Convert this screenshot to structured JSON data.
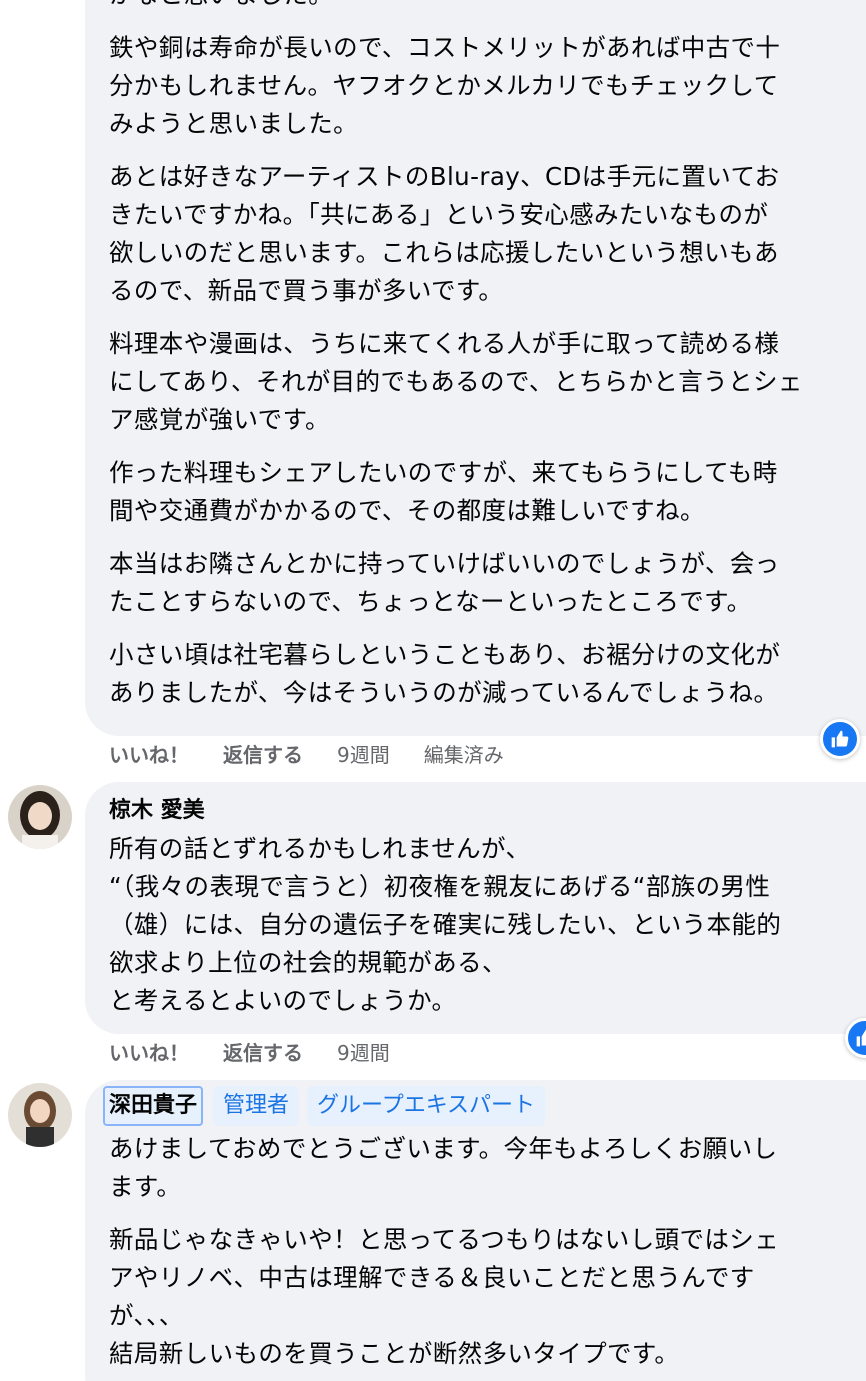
{
  "comment1": {
    "paragraphs": [
      {
        "lines": [
          "かなと思いました。"
        ]
      },
      {
        "lines": [
          "鉄や銅は寿命が長いので、コストメリットがあれば中古で十",
          "分かもしれません。ヤフオクとかメルカリでもチェックして",
          "みようと思いました。"
        ]
      },
      {
        "lines": [
          "あとは好きなアーティストのBlu-ray、CDは手元に置いてお",
          "きたいですかね。「共にある」という安心感みたいなものが",
          "欲しいのだと思います。これらは応援したいという想いもあ",
          "るので、新品で買う事が多いです。"
        ]
      },
      {
        "lines": [
          "料理本や漫画は、うちに来てくれる人が手に取って読める様",
          "にしてあり、それが目的でもあるので、とちらかと言うとシェ",
          "ア感覚が強いです。"
        ]
      },
      {
        "lines": [
          "作った料理もシェアしたいのですが、来てもらうにしても時",
          "間や交通費がかかるので、その都度は難しいですね。"
        ]
      },
      {
        "lines": [
          "本当はお隣さんとかに持っていけばいいのでしょうが、会っ",
          "たことすらないので、ちょっとなーといったところです。"
        ]
      },
      {
        "lines": [
          "小さい頃は社宅暮らしということもあり、お裾分けの文化が",
          "ありましたが、今はそういうのが減っているんでしょうね。"
        ]
      }
    ],
    "actions": {
      "like": "いいね！",
      "reply": "返信する",
      "time": "9週間",
      "edited": "編集済み"
    }
  },
  "comment2": {
    "author": "椋木 愛美",
    "lines": [
      "所有の話とずれるかもしれませんが、",
      "“（我々の表現で言うと）初夜権を親友にあげる“部族の男性",
      "（雄）には、自分の遺伝子を確実に残したい、という本能的",
      "欲求より上位の社会的規範がある、",
      "と考えるとよいのでしょうか。"
    ],
    "actions": {
      "like": "いいね！",
      "reply": "返信する",
      "time": "9週間"
    }
  },
  "comment3": {
    "author": "深田貴子",
    "badges": [
      "管理者",
      "グループエキスパート"
    ],
    "paragraphs": [
      {
        "lines": [
          "あけましておめでとうございます。今年もよろしくお願いし",
          "ます。"
        ]
      },
      {
        "lines": [
          "新品じゃなきゃいや！と思ってるつもりはないし頭ではシェ",
          "アやリノベ、中古は理解できる＆良いことだと思うんです",
          "が、、、",
          "結局新しいものを買うことが断然多いタイプです。"
        ]
      }
    ]
  },
  "colors": {
    "bubble": "#f0f2f5",
    "meta_text": "#65676b",
    "like_blue": "#1877f2",
    "badge_bg": "#e7f0fd",
    "badge_text": "#1b74e4"
  },
  "icons": [
    "like-reaction-icon",
    "avatar"
  ]
}
